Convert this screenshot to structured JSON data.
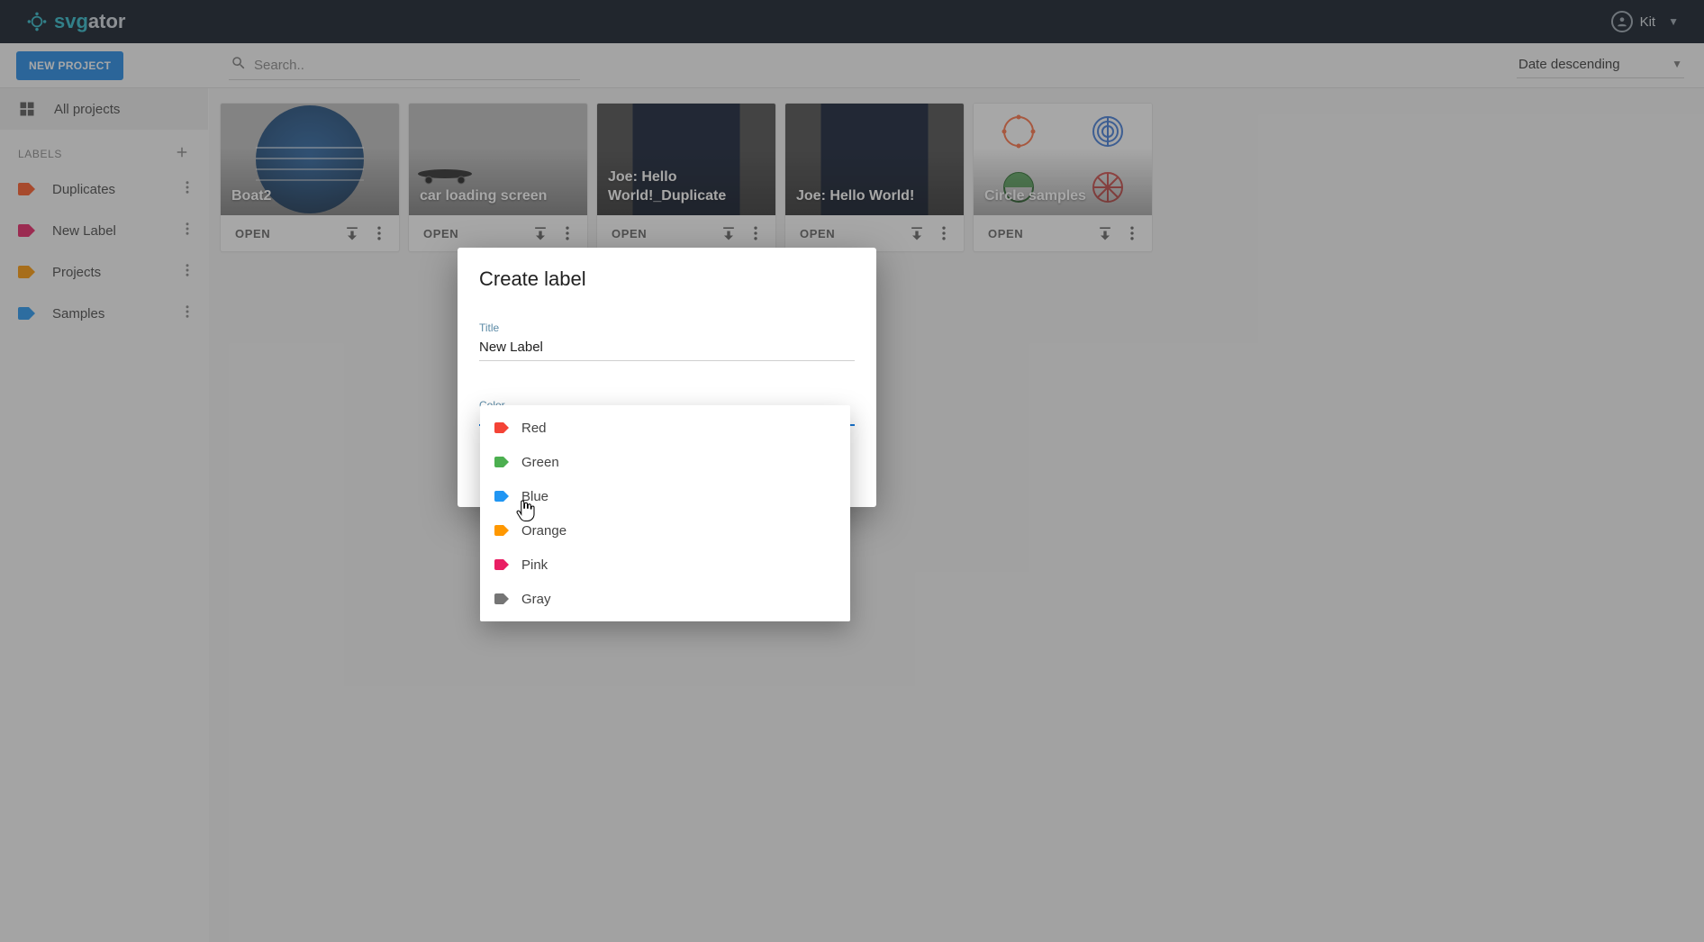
{
  "brand": {
    "name_part1": "svg",
    "name_part2": "ator"
  },
  "account": {
    "name": "Kit"
  },
  "toolbar": {
    "new_project": "NEW PROJECT",
    "search_placeholder": "Search..",
    "sort_label": "Date descending"
  },
  "sidebar": {
    "all_projects": "All projects",
    "labels_header": "LABELS",
    "labels": [
      {
        "name": "Duplicates",
        "color": "#ff5722"
      },
      {
        "name": "New Label",
        "color": "#e91e63"
      },
      {
        "name": "Projects",
        "color": "#ff9800"
      },
      {
        "name": "Samples",
        "color": "#2196f3"
      }
    ]
  },
  "projects": [
    {
      "title": "Boat2",
      "open": "OPEN",
      "bg": "gray",
      "kind": "boat"
    },
    {
      "title": "car loading screen",
      "open": "OPEN",
      "bg": "gray",
      "kind": "car"
    },
    {
      "title": "Joe: Hello World!_Duplicate",
      "open": "OPEN",
      "bg": "dark",
      "kind": "dark"
    },
    {
      "title": "Joe: Hello World!",
      "open": "OPEN",
      "bg": "dark",
      "kind": "dark"
    },
    {
      "title": "Circle samples",
      "open": "OPEN",
      "bg": "light",
      "kind": "circles"
    }
  ],
  "modal": {
    "heading": "Create label",
    "title_label": "Title",
    "title_value": "New Label",
    "color_label": "Color",
    "colors": [
      {
        "name": "Red",
        "hex": "#f44336"
      },
      {
        "name": "Green",
        "hex": "#4caf50"
      },
      {
        "name": "Blue",
        "hex": "#2196f3"
      },
      {
        "name": "Orange",
        "hex": "#ff9800"
      },
      {
        "name": "Pink",
        "hex": "#e91e63"
      },
      {
        "name": "Gray",
        "hex": "#757575"
      }
    ]
  }
}
